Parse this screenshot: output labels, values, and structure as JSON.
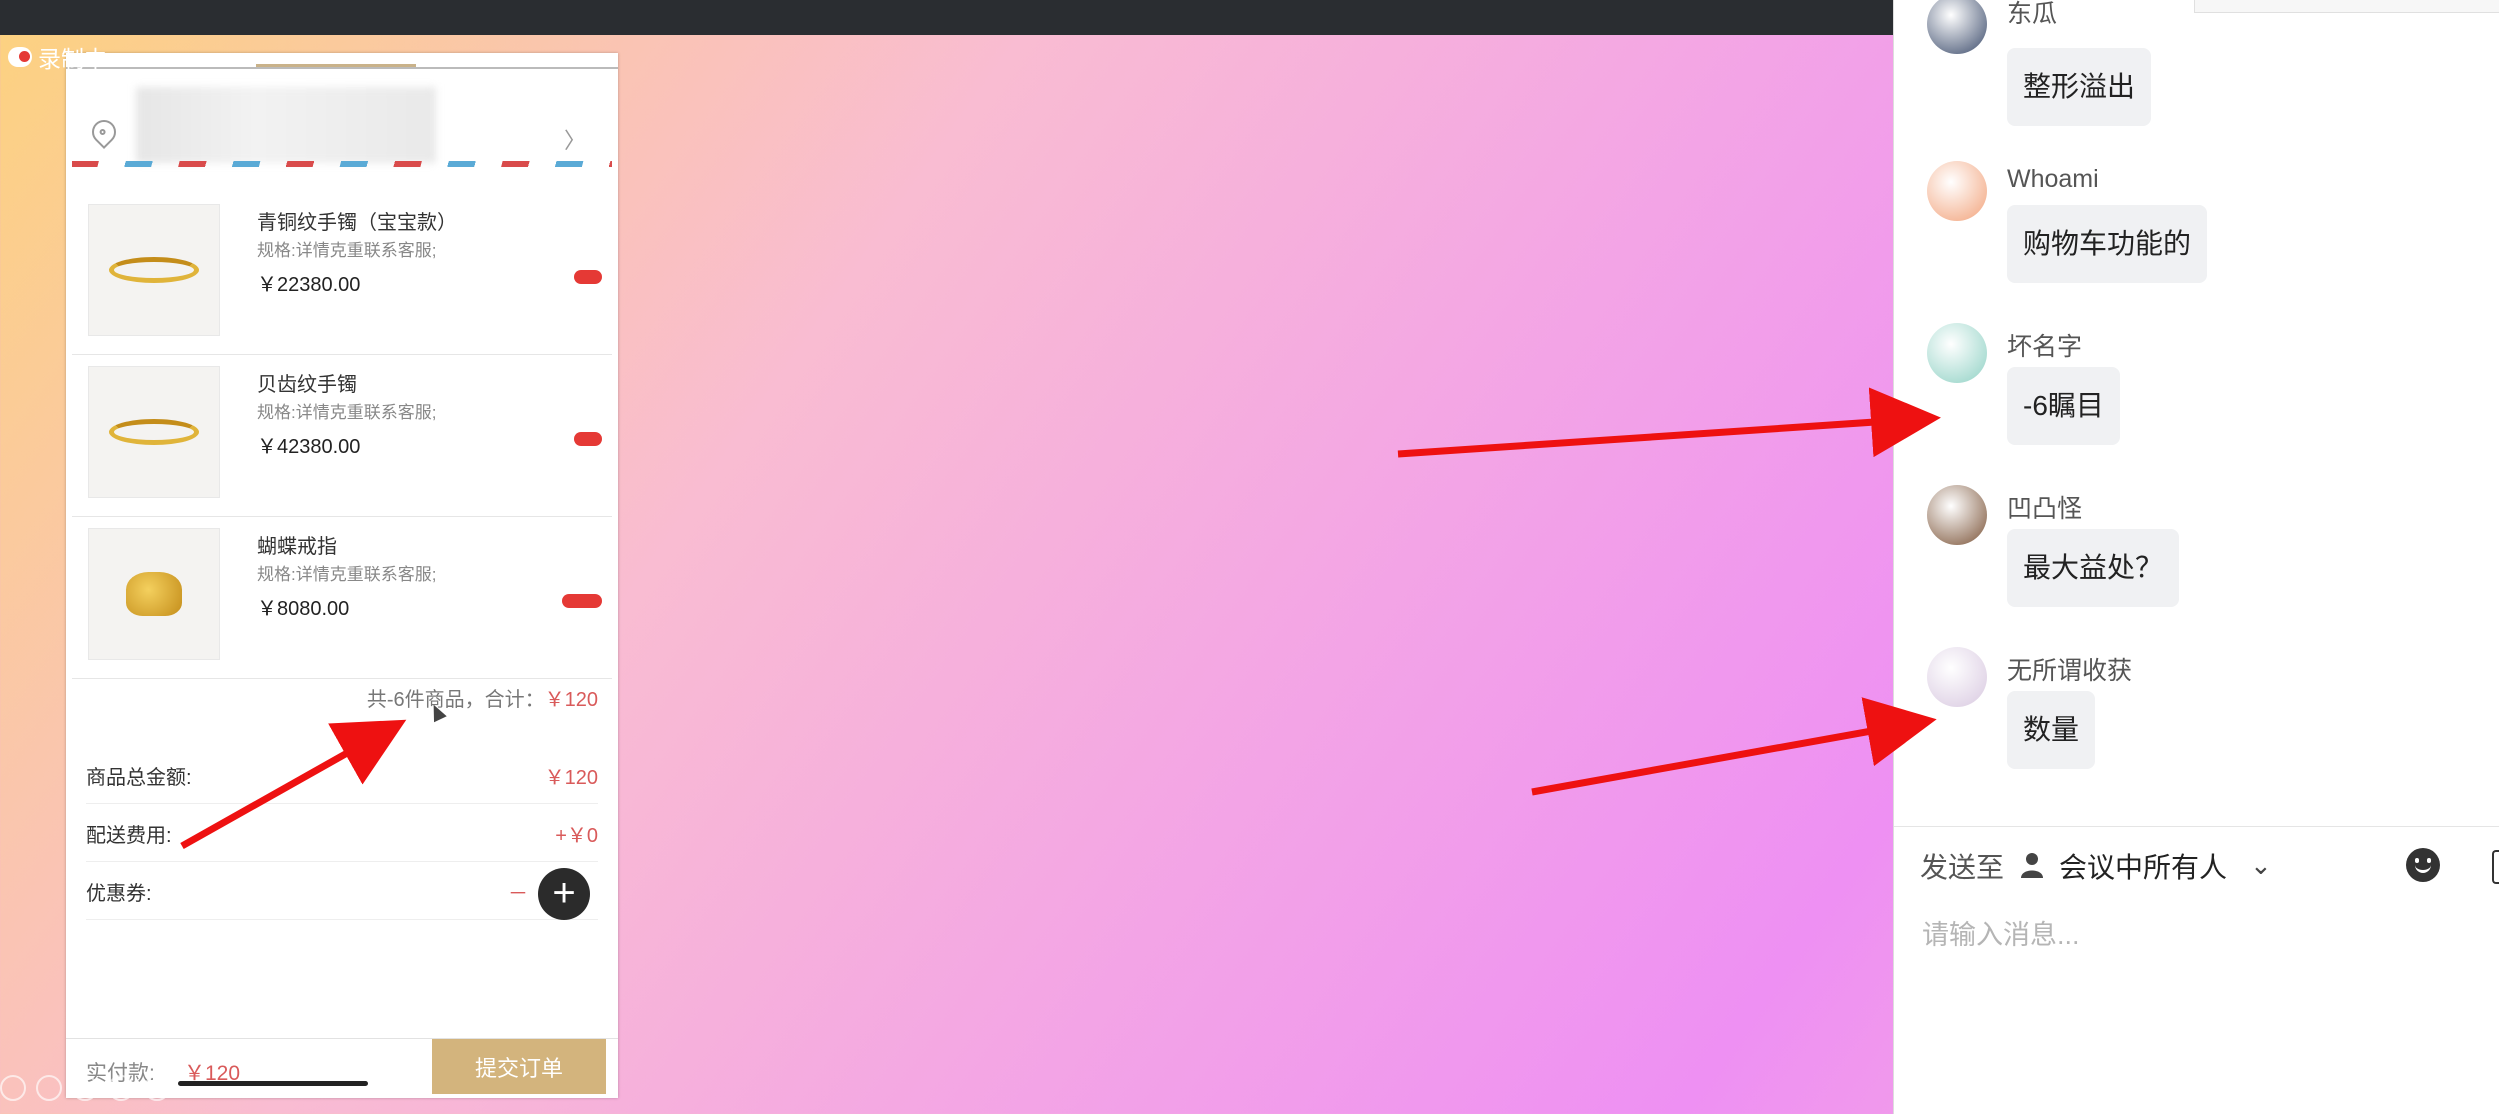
{
  "recording": {
    "label": "录制中"
  },
  "cart": {
    "items": [
      {
        "name": "青铜纹手镯（宝宝款）",
        "spec": "规格:详情克重联系客服;",
        "price": "￥22380.00",
        "image": "bangle"
      },
      {
        "name": "贝齿纹手镯",
        "spec": "规格:详情克重联系客服;",
        "price": "￥42380.00",
        "image": "bangle"
      },
      {
        "name": "蝴蝶戒指",
        "spec": "规格:详情克重联系客服;",
        "price": "￥8080.00",
        "image": "ring"
      }
    ],
    "summary_prefix": "共-6件商品，合计：",
    "summary_amount": "￥120",
    "goods_total_label": "商品总金额:",
    "goods_total_value": "￥120",
    "shipping_label": "配送费用:",
    "shipping_value": "+￥0",
    "coupon_label": "优惠券:",
    "coupon_value": "－",
    "pay_label": "实付款:",
    "pay_amount": "￥120",
    "submit_label": "提交订单"
  },
  "chat": {
    "messages": [
      {
        "name": "东瓜",
        "text": "整形溢出",
        "avatar_color": "#3a4a6a"
      },
      {
        "name": "Whoami",
        "text": "购物车功能的",
        "avatar_color": "#f2a27a"
      },
      {
        "name": "坏名字",
        "text": "-6瞩目",
        "avatar_color": "#8fd1c4"
      },
      {
        "name": "凹凸怪",
        "text": "最大益处？",
        "avatar_color": "#7a5236"
      },
      {
        "name": "无所谓收获",
        "text": "数量",
        "avatar_color": "#d8c8e0"
      }
    ],
    "send_to_label": "发送至",
    "send_to_target": "会议中所有人",
    "input_placeholder": "请输入消息..."
  },
  "icons": {
    "location": "location-pin-icon",
    "add": "plus-icon",
    "person": "person-icon",
    "chevron": "chevron-down-icon",
    "emoji": "emoji-icon",
    "image": "image-icon"
  },
  "colors": {
    "price_red": "#d95a5a",
    "submit_gold": "#d3b47d",
    "arrow_red": "#ee1111"
  }
}
